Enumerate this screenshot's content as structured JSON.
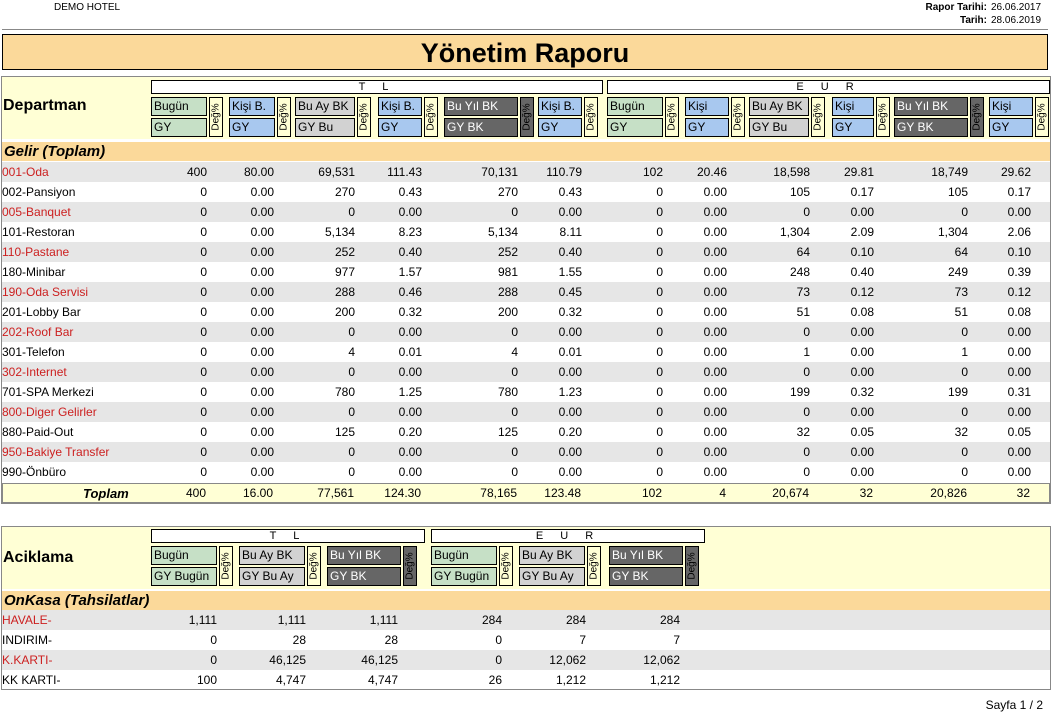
{
  "hotel": "DEMO HOTEL",
  "report_date_label": "Rapor Tarihi:",
  "report_date": "26.06.2017",
  "date_label": "Tarih:",
  "date": "28.06.2019",
  "title": "Yönetim Raporu",
  "table1": {
    "row_label": "Departman",
    "group_tl": "T L",
    "group_eur": "E U R",
    "deg": "Değ%",
    "tl_top": [
      "Bugün",
      "Kişi B.",
      "Bu Ay BK",
      "Kişi B.",
      "Bu Yıl BK",
      "Kişi B."
    ],
    "tl_bottom": [
      "GY",
      "GY",
      "GY Bu",
      "GY",
      "GY BK",
      "GY"
    ],
    "eur_top": [
      "Bugün",
      "Kişi",
      "Bu Ay BK",
      "Kişi",
      "Bu Yıl BK",
      "Kişi"
    ],
    "eur_bottom": [
      "GY",
      "GY",
      "GY Bu",
      "GY",
      "GY BK",
      "GY"
    ],
    "section": "Gelir (Toplam)",
    "rows": [
      {
        "name": "001-Oda",
        "red": true,
        "v": [
          "400",
          "80.00",
          "69,531",
          "111.43",
          "70,131",
          "110.79",
          "102",
          "20.46",
          "18,598",
          "29.81",
          "18,749",
          "29.62"
        ]
      },
      {
        "name": "002-Pansiyon",
        "red": false,
        "v": [
          "0",
          "0.00",
          "270",
          "0.43",
          "270",
          "0.43",
          "0",
          "0.00",
          "105",
          "0.17",
          "105",
          "0.17"
        ]
      },
      {
        "name": "005-Banquet",
        "red": true,
        "v": [
          "0",
          "0.00",
          "0",
          "0.00",
          "0",
          "0.00",
          "0",
          "0.00",
          "0",
          "0.00",
          "0",
          "0.00"
        ]
      },
      {
        "name": "101-Restoran",
        "red": false,
        "v": [
          "0",
          "0.00",
          "5,134",
          "8.23",
          "5,134",
          "8.11",
          "0",
          "0.00",
          "1,304",
          "2.09",
          "1,304",
          "2.06"
        ]
      },
      {
        "name": "110-Pastane",
        "red": true,
        "v": [
          "0",
          "0.00",
          "252",
          "0.40",
          "252",
          "0.40",
          "0",
          "0.00",
          "64",
          "0.10",
          "64",
          "0.10"
        ]
      },
      {
        "name": "180-Minibar",
        "red": false,
        "v": [
          "0",
          "0.00",
          "977",
          "1.57",
          "981",
          "1.55",
          "0",
          "0.00",
          "248",
          "0.40",
          "249",
          "0.39"
        ]
      },
      {
        "name": "190-Oda Servisi",
        "red": true,
        "v": [
          "0",
          "0.00",
          "288",
          "0.46",
          "288",
          "0.45",
          "0",
          "0.00",
          "73",
          "0.12",
          "73",
          "0.12"
        ]
      },
      {
        "name": "201-Lobby Bar",
        "red": false,
        "v": [
          "0",
          "0.00",
          "200",
          "0.32",
          "200",
          "0.32",
          "0",
          "0.00",
          "51",
          "0.08",
          "51",
          "0.08"
        ]
      },
      {
        "name": "202-Roof Bar",
        "red": true,
        "v": [
          "0",
          "0.00",
          "0",
          "0.00",
          "0",
          "0.00",
          "0",
          "0.00",
          "0",
          "0.00",
          "0",
          "0.00"
        ]
      },
      {
        "name": "301-Telefon",
        "red": false,
        "v": [
          "0",
          "0.00",
          "4",
          "0.01",
          "4",
          "0.01",
          "0",
          "0.00",
          "1",
          "0.00",
          "1",
          "0.00"
        ]
      },
      {
        "name": "302-Internet",
        "red": true,
        "v": [
          "0",
          "0.00",
          "0",
          "0.00",
          "0",
          "0.00",
          "0",
          "0.00",
          "0",
          "0.00",
          "0",
          "0.00"
        ]
      },
      {
        "name": "701-SPA Merkezi",
        "red": false,
        "v": [
          "0",
          "0.00",
          "780",
          "1.25",
          "780",
          "1.23",
          "0",
          "0.00",
          "199",
          "0.32",
          "199",
          "0.31"
        ]
      },
      {
        "name": "800-Diger Gelirler",
        "red": true,
        "v": [
          "0",
          "0.00",
          "0",
          "0.00",
          "0",
          "0.00",
          "0",
          "0.00",
          "0",
          "0.00",
          "0",
          "0.00"
        ]
      },
      {
        "name": "880-Paid-Out",
        "red": false,
        "v": [
          "0",
          "0.00",
          "125",
          "0.20",
          "125",
          "0.20",
          "0",
          "0.00",
          "32",
          "0.05",
          "32",
          "0.05"
        ]
      },
      {
        "name": "950-Bakiye Transfer",
        "red": true,
        "v": [
          "0",
          "0.00",
          "0",
          "0.00",
          "0",
          "0.00",
          "0",
          "0.00",
          "0",
          "0.00",
          "0",
          "0.00"
        ]
      },
      {
        "name": "990-Önbüro",
        "red": false,
        "v": [
          "0",
          "0.00",
          "0",
          "0.00",
          "0",
          "0.00",
          "0",
          "0.00",
          "0",
          "0.00",
          "0",
          "0.00"
        ]
      }
    ],
    "total": {
      "name": "Toplam",
      "v": [
        "400",
        "16.00",
        "77,561",
        "124.30",
        "78,165",
        "123.48",
        "102",
        "4",
        "20,674",
        "32",
        "20,826",
        "32"
      ]
    }
  },
  "table2": {
    "row_label": "Aciklama",
    "group_tl": "T L",
    "group_eur": "E U R",
    "deg": "Değ%",
    "tl_top": [
      "Bugün",
      "Bu Ay BK",
      "Bu Yıl BK"
    ],
    "tl_bottom": [
      "GY Bugün",
      "GY Bu Ay",
      "GY BK"
    ],
    "eur_top": [
      "Bugün",
      "Bu Ay BK",
      "Bu Yıl BK"
    ],
    "eur_bottom": [
      "GY Bugün",
      "GY Bu Ay",
      "GY BK"
    ],
    "section": "OnKasa (Tahsilatlar)",
    "rows": [
      {
        "name": "HAVALE-",
        "red": true,
        "v": [
          "1,111",
          "1,111",
          "1,111",
          "284",
          "284",
          "284"
        ]
      },
      {
        "name": "INDIRIM-",
        "red": false,
        "v": [
          "0",
          "28",
          "28",
          "0",
          "7",
          "7"
        ]
      },
      {
        "name": "K.KARTI-",
        "red": true,
        "v": [
          "0",
          "46,125",
          "46,125",
          "0",
          "12,062",
          "12,062"
        ]
      },
      {
        "name": "KK KARTI-",
        "red": false,
        "v": [
          "100",
          "4,747",
          "4,747",
          "26",
          "1,212",
          "1,212"
        ]
      }
    ]
  },
  "footer": "Sayfa 1 / 2"
}
